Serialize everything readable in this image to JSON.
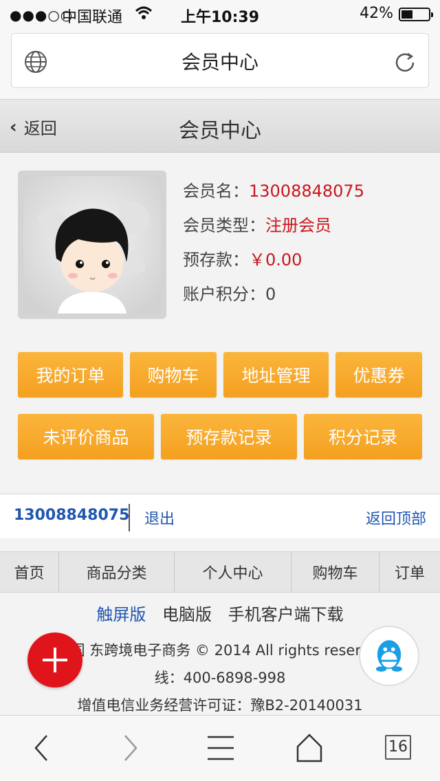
{
  "status_bar": {
    "signal": "●●●○○",
    "carrier": "中国联通",
    "wifi_icon": "wifi-icon",
    "time": "上午10:39",
    "battery": "42%",
    "battery_level": 0.42
  },
  "browser": {
    "title": "会员中心",
    "globe_icon": "globe-icon",
    "reload_icon": "reload-icon"
  },
  "header": {
    "back_label": "返回",
    "title": "会员中心"
  },
  "member": {
    "name_label": "会员名：",
    "name_value": "13008848075",
    "type_label": "会员类型：",
    "type_value": "注册会员",
    "deposit_label": "预存款：",
    "deposit_value": "￥0.00",
    "points_label": "账户积分：",
    "points_value": "0"
  },
  "actions": {
    "row1": [
      "我的订单",
      "购物车",
      "地址管理",
      "优惠券"
    ],
    "row2": [
      "未评价商品",
      "预存款记录",
      "积分记录"
    ]
  },
  "userbar": {
    "username": "13008848075",
    "logout": "退出",
    "back_to_top": "返回顶部"
  },
  "footer_nav": [
    "首页",
    "商品分类",
    "个人中心",
    "购物车",
    "订单"
  ],
  "versions": {
    "touch": "触屏版",
    "pc": "电脑版",
    "app": "手机客户端下载"
  },
  "copyright": {
    "line1": "© 国 东跨境电子商务 © 2014 All rights reserv 热",
    "line2": "线：400-6898-998",
    "line3": "增值电信业务经营许可证：豫B2-20140031"
  },
  "toolbar": {
    "tabs_count": "16"
  },
  "colors": {
    "accent_orange": "#f7a928",
    "link_blue": "#1f56b0",
    "value_red": "#c8161d",
    "fab_red": "#e0141b"
  }
}
